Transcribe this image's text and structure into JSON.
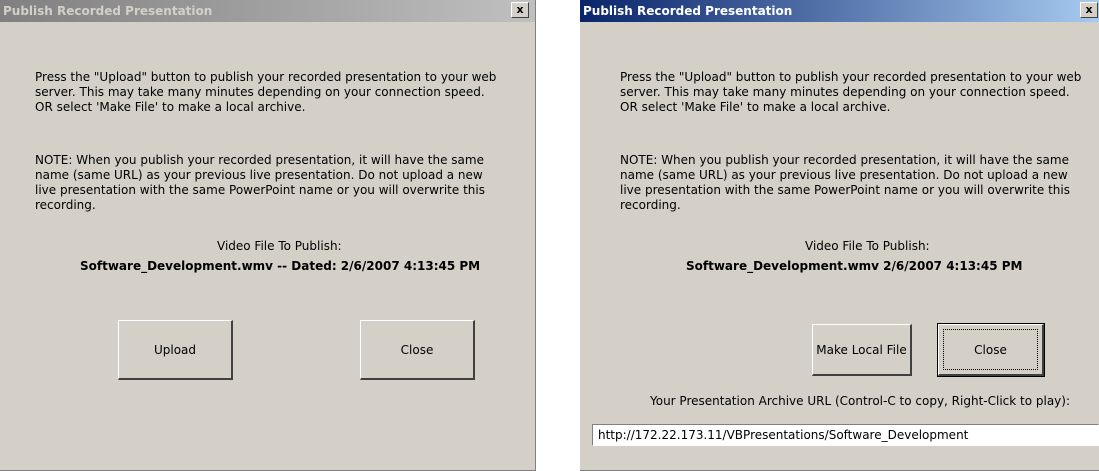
{
  "left_dialog": {
    "title": "Publish Recorded Presentation",
    "close_glyph": "x",
    "instructions": "Press the \"Upload\" button to publish your recorded presentation to your web server.  This may take many minutes depending on your connection speed.  OR select 'Make File' to make a local archive.",
    "note": "NOTE: When you publish your recorded presentation, it will have the same name (same URL) as your previous live presentation. Do not upload a new live presentation with the same PowerPoint name or you will overwrite this recording.",
    "video_label": "Video File To Publish:",
    "video_file": "Software_Development.wmv -- Dated: 2/6/2007 4:13:45 PM",
    "upload_label": "Upload",
    "close_label": "Close"
  },
  "right_dialog": {
    "title": "Publish Recorded Presentation",
    "close_glyph": "x",
    "instructions": "Press the \"Upload\" button to publish your recorded presentation to your web server.  This may take many minutes depending on your connection speed.  OR select 'Make File' to make a local archive.",
    "note": "NOTE: When you publish your recorded presentation, it will have the same name (same URL) as your previous live presentation. Do not upload a new live presentation with the same PowerPoint name or you will overwrite this recording.",
    "video_label": "Video File To Publish:",
    "video_file": "Software_Development.wmv   2/6/2007 4:13:45 PM",
    "make_local_file_label": "Make Local File",
    "close_label": "Close",
    "archive_label": "Your Presentation Archive URL (Control-C to copy, Right-Click to play):",
    "archive_url": "http://172.22.173.11/VBPresentations/Software_Development"
  },
  "colors": {
    "dialog_face": "#d4d0c8",
    "active_title_start": "#0a246a",
    "active_title_end": "#a6caf0",
    "inactive_title_start": "#808080",
    "inactive_title_end": "#c0c0c0"
  },
  "icons": {
    "close": "close-icon"
  }
}
